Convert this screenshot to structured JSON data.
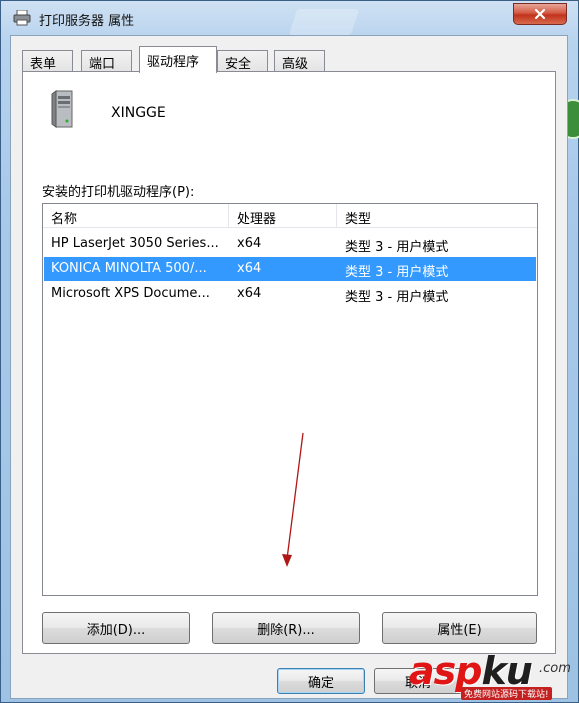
{
  "window": {
    "title": "打印服务器 属性",
    "close_glyph": "✕"
  },
  "tabs": [
    {
      "label": "表单",
      "active": false
    },
    {
      "label": "端口",
      "active": false
    },
    {
      "label": "驱动程序",
      "active": true
    },
    {
      "label": "安全",
      "active": false
    },
    {
      "label": "高级",
      "active": false
    }
  ],
  "server": {
    "name": "XINGGE",
    "icon": "server-icon"
  },
  "drivers": {
    "label": "安装的打印机驱动程序(P):",
    "columns": [
      "名称",
      "处理器",
      "类型"
    ],
    "rows": [
      {
        "name": "HP LaserJet 3050 Series...",
        "processor": "x64",
        "type": "类型 3 - 用户模式",
        "selected": false
      },
      {
        "name": "KONICA MINOLTA 500/...",
        "processor": "x64",
        "type": "类型 3 - 用户模式",
        "selected": true
      },
      {
        "name": "Microsoft XPS Docume...",
        "processor": "x64",
        "type": "类型 3 - 用户模式",
        "selected": false
      }
    ]
  },
  "buttons": {
    "add": "添加(D)...",
    "remove": "删除(R)...",
    "properties": "属性(E)",
    "ok": "确定",
    "cancel": "取消"
  },
  "annotation": {
    "arrow_color": "#b01818"
  },
  "watermark": {
    "text_asp": "asp",
    "text_ku": "ku",
    "dotcom": ".com",
    "tagline": "免费网站源码下载站!"
  },
  "colors": {
    "selection": "#3399ff",
    "close_button": "#c1321c"
  }
}
